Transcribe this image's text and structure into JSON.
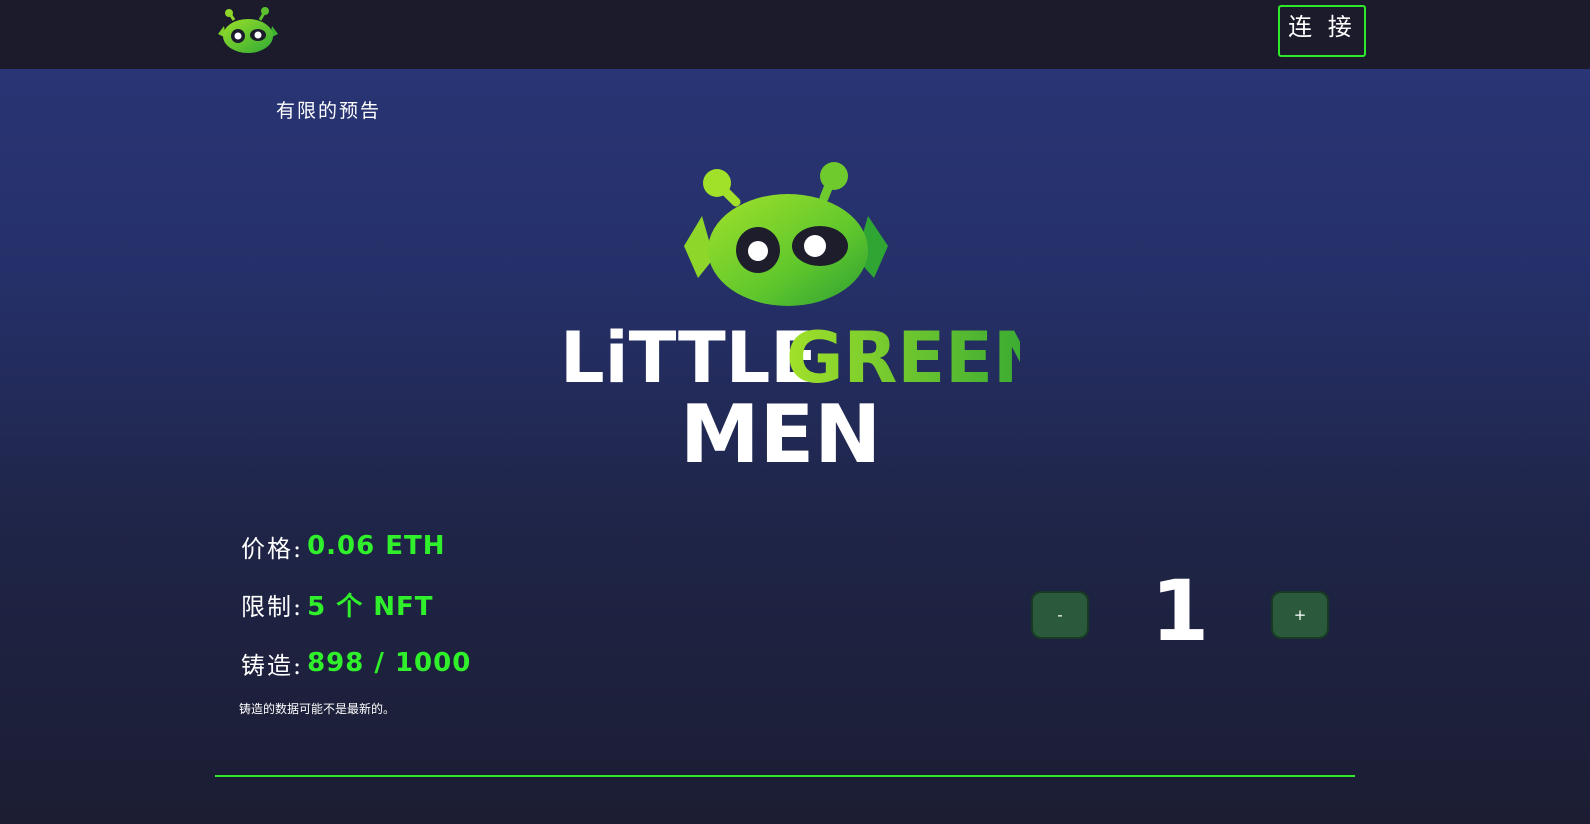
{
  "header": {
    "logo_icon": "alien-head-icon",
    "connect_label": "连 接"
  },
  "presale": {
    "label": "有限的预告"
  },
  "hero": {
    "title_word1": "LiTTLE",
    "title_word2": "GREEN",
    "title_word3": "MEN"
  },
  "stats": {
    "price_label": "价格:",
    "price_value": "0.06 ETH",
    "limit_label": "限制:",
    "limit_value": "5 个 NFT",
    "minted_label": "铸造:",
    "minted_value": "898 / 1000",
    "note": "铸造的数据可能不是最新的。"
  },
  "quantity": {
    "minus_label": "-",
    "value": "1",
    "plus_label": "+"
  },
  "colors": {
    "accent": "#2fe82b",
    "topbar": "#1c1b2b",
    "button": "#2a5a3b"
  }
}
